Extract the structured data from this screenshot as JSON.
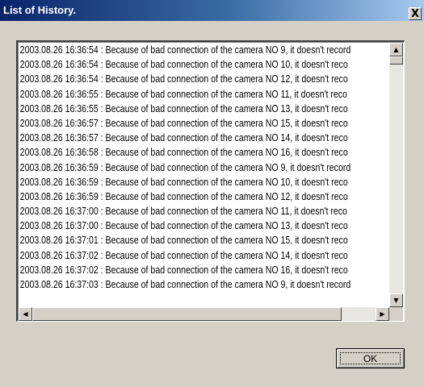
{
  "window": {
    "title": "List of History.",
    "close_label": "X"
  },
  "history": {
    "items": [
      "2003.08.26 16:36:54 : Because of bad connection of the camera NO 9, it doesn't record",
      "2003.08.26 16:36:54 : Because of bad connection of the camera NO 10, it doesn't reco",
      "2003.08.26 16:36:54 : Because of bad connection of the camera NO 12, it doesn't reco",
      "2003.08.26 16:36:55 : Because of bad connection of the camera NO 11, it doesn't reco",
      "2003.08.26 16:36:55 : Because of bad connection of the camera NO 13, it doesn't reco",
      "2003.08.26 16:36:57 : Because of bad connection of the camera NO 15, it doesn't reco",
      "2003.08.26 16:36:57 : Because of bad connection of the camera NO 14, it doesn't reco",
      "2003.08.26 16:36:58 : Because of bad connection of the camera NO 16, it doesn't reco",
      "2003.08.26 16:36:59 : Because of bad connection of the camera NO 9, it doesn't record",
      "2003.08.26 16:36:59 : Because of bad connection of the camera NO 10, it doesn't reco",
      "2003.08.26 16:36:59 : Because of bad connection of the camera NO 12, it doesn't reco",
      "2003.08.26 16:37:00 : Because of bad connection of the camera NO 11, it doesn't reco",
      "2003.08.26 16:37:00 : Because of bad connection of the camera NO 13, it doesn't reco",
      "2003.08.26 16:37:01 : Because of bad connection of the camera NO 15, it doesn't reco",
      "2003.08.26 16:37:02 : Because of bad connection of the camera NO 14, it doesn't reco",
      "2003.08.26 16:37:02 : Because of bad connection of the camera NO 16, it doesn't reco",
      "2003.08.26 16:37:03 : Because of bad connection of the camera NO 9, it doesn't record"
    ]
  },
  "scrollbars": {
    "up_icon": "arrow-up-icon",
    "down_icon": "arrow-down-icon",
    "left_icon": "arrow-left-icon",
    "right_icon": "arrow-right-icon"
  },
  "buttons": {
    "ok_label": "OK"
  },
  "colors": {
    "title_start": "#0a246a",
    "title_end": "#a6caf0",
    "face": "#d4d0c8"
  }
}
